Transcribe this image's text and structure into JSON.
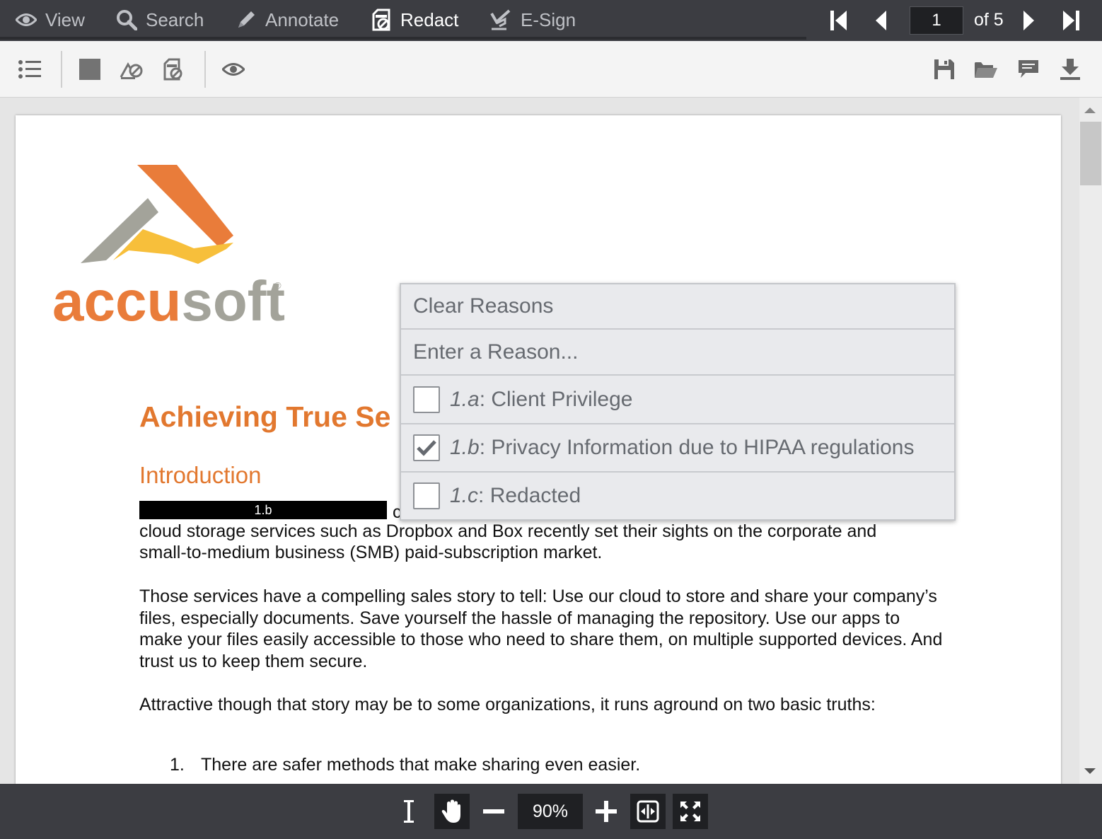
{
  "tabs": [
    {
      "label": "View",
      "icon": "eye-icon",
      "active": false
    },
    {
      "label": "Search",
      "icon": "search-icon",
      "active": false
    },
    {
      "label": "Annotate",
      "icon": "pencil-icon",
      "active": false
    },
    {
      "label": "Redact",
      "icon": "redact-icon",
      "active": true
    },
    {
      "label": "E-Sign",
      "icon": "signature-icon",
      "active": false
    }
  ],
  "pagination": {
    "current": "1",
    "of_label": "of 5"
  },
  "toolbar": {
    "left_icons": [
      "list-icon",
      "rectangle-redact-icon",
      "text-redact-icon",
      "page-redact-icon",
      "preview-eye-icon"
    ],
    "right_icons": [
      "save-icon",
      "open-folder-icon",
      "comment-icon",
      "download-icon"
    ]
  },
  "document": {
    "title": "Achieving True Se",
    "intro": "Introduction",
    "redaction_label": "1.b",
    "para1_partial": "c",
    "para1_line2": "cloud storage services such as Dropbox and Box recently set their sights on the corporate and",
    "para1_line3": "small-to-medium business (SMB) paid-subscription market.",
    "para2": "Those services have a compelling sales story to tell: Use our cloud to store and share your company’s files, especially documents. Save yourself the hassle of managing the repository. Use our apps to make your files easily accessible to those who need to share them, on multiple supported devices. And trust us to keep them secure.",
    "para3": "Attractive though that story may be to some organizations, it runs aground on two basic truths:",
    "list": [
      {
        "num": "1.",
        "text": "There are safer methods that make sharing even easier."
      }
    ],
    "logo_text": "accusoft",
    "logo_mark": "®"
  },
  "reasons_menu": {
    "clear_label": "Clear Reasons",
    "enter_placeholder": "Enter a Reason...",
    "items": [
      {
        "code": "1.a",
        "label": "Client Privilege",
        "checked": false
      },
      {
        "code": "1.b",
        "label": "Privacy Information due to HIPAA regulations",
        "checked": true
      },
      {
        "code": "1.c",
        "label": "Redacted",
        "checked": false
      }
    ]
  },
  "bottombar": {
    "zoom": "90%"
  },
  "colors": {
    "accent_orange": "#e2782f",
    "toolbar_dark": "#3c3d42",
    "logo_gray": "#a3a39a",
    "logo_yellow": "#f7bf3b"
  }
}
